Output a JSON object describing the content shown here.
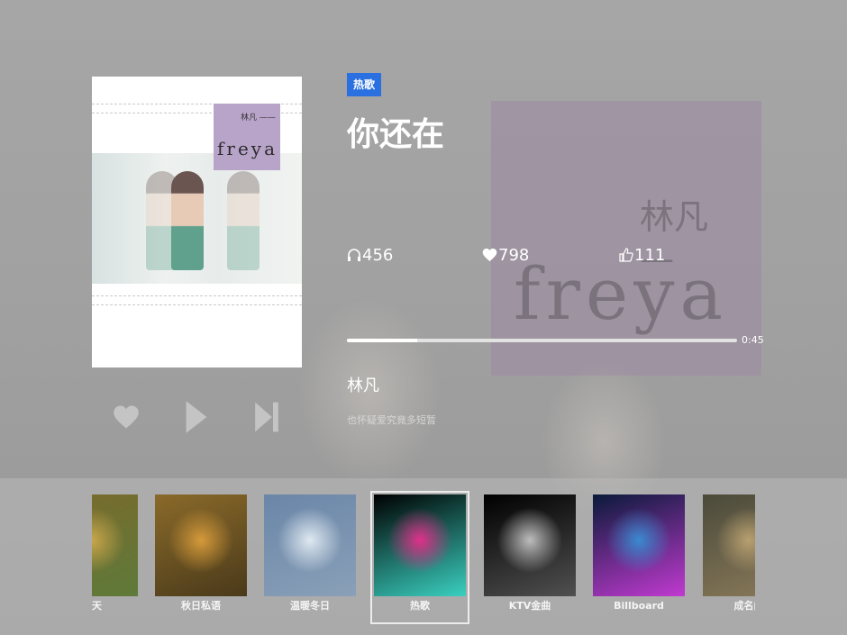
{
  "now_playing": {
    "tag": "热歌",
    "title": "你还在",
    "artist": "林凡",
    "lyric": "也怀疑爱究竟多短暂",
    "cover": {
      "artist_text": "林凡 ——",
      "album_text": "freya"
    },
    "stats": {
      "listens": "456",
      "likes": "798",
      "thumbs": "111"
    },
    "progress": {
      "fraction": 0.18,
      "time": "0:45"
    }
  },
  "controls": {
    "like_icon": "heart-icon",
    "play_icon": "play-icon",
    "next_icon": "next-icon"
  },
  "categories": [
    {
      "label": "春天",
      "colors": [
        "#7a6a2c",
        "#c9a64b",
        "#5e7a3a"
      ]
    },
    {
      "label": "秋日私语",
      "colors": [
        "#8a6a2a",
        "#d59a3a",
        "#4a3a1a"
      ]
    },
    {
      "label": "温暖冬日",
      "colors": [
        "#6a86a8",
        "#dfe9f1",
        "#8aa0b8"
      ]
    },
    {
      "label": "热歌",
      "colors": [
        "#000000",
        "#e0308a",
        "#3ad0c0"
      ]
    },
    {
      "label": "KTV金曲",
      "colors": [
        "#000000",
        "#bdbdbd",
        "#505050"
      ]
    },
    {
      "label": "Billboard",
      "colors": [
        "#0a1a3a",
        "#3a8ad0",
        "#c03ad0"
      ]
    },
    {
      "label": "成名曲",
      "colors": [
        "#4a4a3a",
        "#b8a070",
        "#8a7a5a"
      ]
    }
  ],
  "active_category_index": 3
}
